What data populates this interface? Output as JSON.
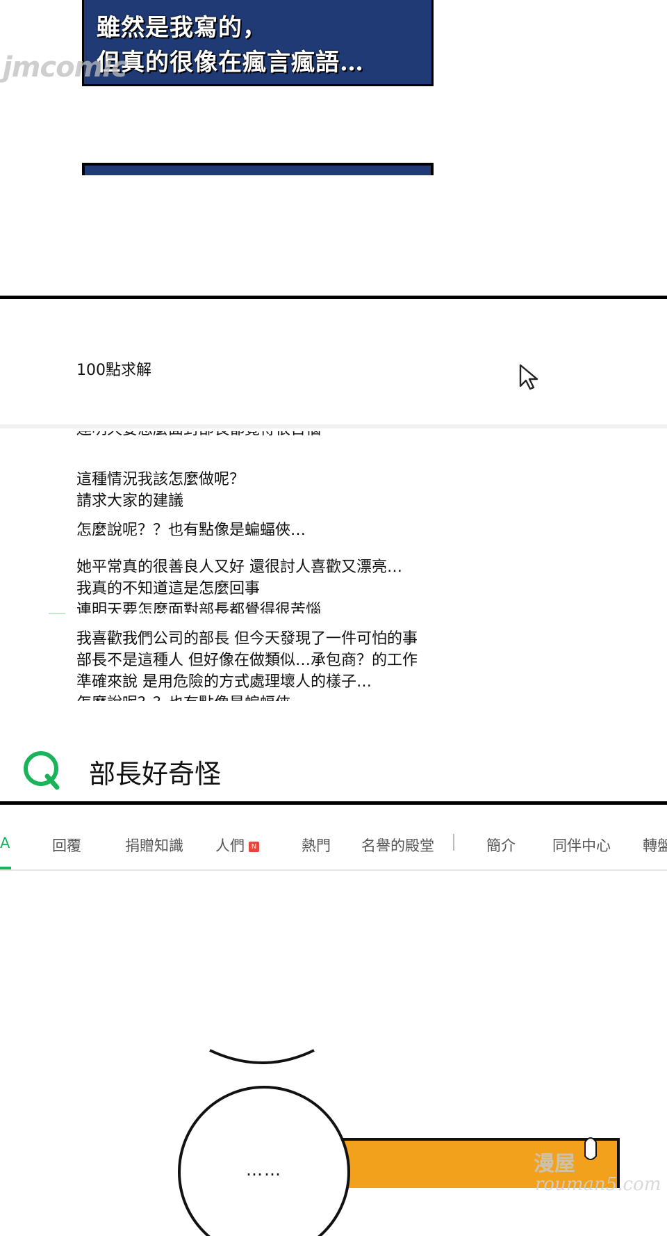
{
  "narration": {
    "line1": "雖然是我寫的，",
    "line2": "但真的很像在瘋言瘋語…"
  },
  "watermark_top": "jmcomic",
  "question": {
    "title": "100點求解"
  },
  "post_lower": {
    "clipped_top": "連明天要怎麼面對部長都覺得很苦惱",
    "line1": "這種情況我該怎麼做呢？",
    "line2": "請求大家的建議",
    "clipped_bottom": "怎麼說呢？？也有點像是蝙蝠俠…"
  },
  "post_middle": {
    "line1": "她平常真的很善良人又好 還很討人喜歡又漂亮…",
    "line2": "我真的不知道這是怎麼回事",
    "clipped_bottom": "連明天要怎麼面對部長都覺得很苦惱"
  },
  "post_top": {
    "line1": "我喜歡我們公司的部長 但今天發現了一件可怕的事",
    "line2": "部長不是這種人 但好像在做類似…承包商？的工作",
    "line3": "準確來說 是用危險的方式處理壞人的樣子…",
    "clipped_bottom": "怎麼說呢？？也有點像是蝙蝠俠…"
  },
  "search": {
    "query": "部長好奇怪"
  },
  "tabs": [
    {
      "label": "A",
      "active": true
    },
    {
      "label": "回覆"
    },
    {
      "label": "捐贈知識"
    },
    {
      "label": "人們",
      "badge": "N"
    },
    {
      "label": "熱門"
    },
    {
      "label": "名譽的殿堂"
    },
    {
      "label": "簡介"
    },
    {
      "label": "同伴中心"
    },
    {
      "label": "轉盤"
    }
  ],
  "speech_bubble": "……",
  "watermark_bottom": {
    "line1": "漫屋",
    "line2": "rouman5.com"
  },
  "colors": {
    "narration_bg": "#1f3a74",
    "accent_green": "#19b35a",
    "badge_red": "#e8463c",
    "orange_panel": "#f2a11d"
  }
}
